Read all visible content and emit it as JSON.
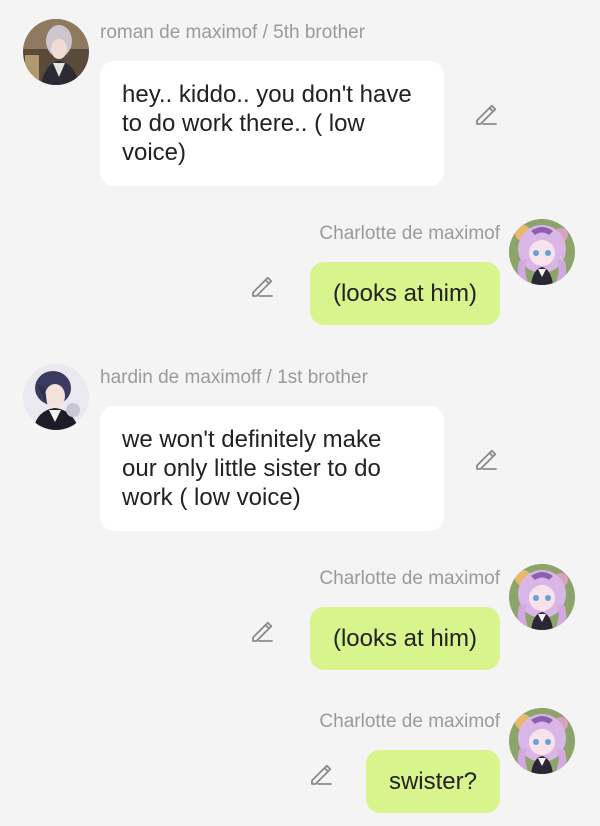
{
  "messages": [
    {
      "side": "in",
      "sender": "roman de maximof / 5th brother",
      "avatar": "roman-avatar",
      "text": "hey.. kiddo.. you don't have to do work there.. ( low voice)"
    },
    {
      "side": "out",
      "sender": "Charlotte de maximof",
      "avatar": "charlotte-avatar",
      "text": "(looks at him)"
    },
    {
      "side": "in",
      "sender": "hardin de maximoff / 1st brother",
      "avatar": "hardin-avatar",
      "text": "we won't definitely make our only little sister to do work ( low voice)"
    },
    {
      "side": "out",
      "sender": "Charlotte de maximof",
      "avatar": "charlotte-avatar",
      "text": "(looks at him)"
    },
    {
      "side": "out",
      "sender": "Charlotte de maximof",
      "avatar": "charlotte-avatar",
      "text": "swister?"
    }
  ],
  "icons": {
    "edit": "pencil-edit-icon"
  },
  "colors": {
    "background": "#f4f4f4",
    "incoming_bubble": "#ffffff",
    "outgoing_bubble": "#d8f48c",
    "sender_name": "#9a9a9a",
    "message_text": "#222222"
  }
}
